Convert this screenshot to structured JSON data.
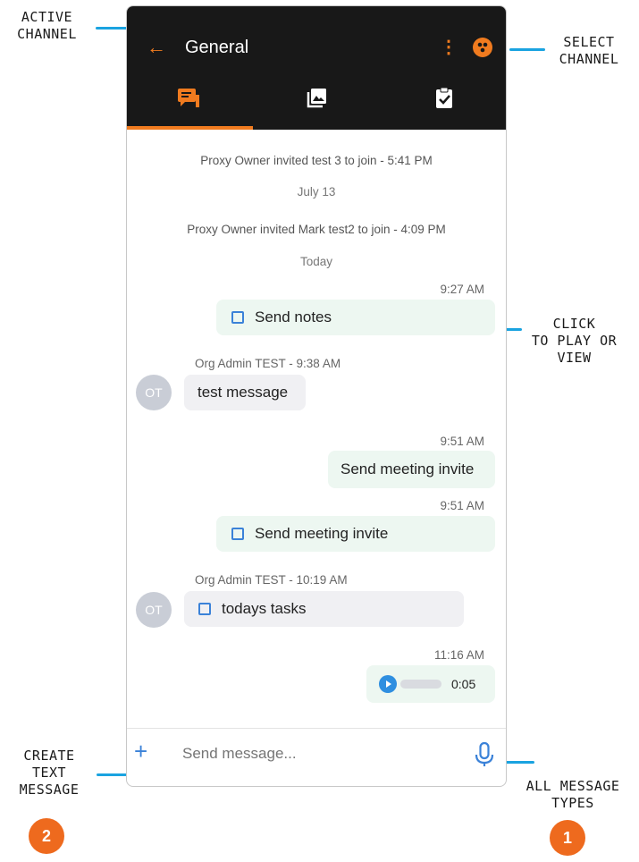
{
  "callouts": {
    "active_channel": [
      "ACTIVE",
      "CHANNEL"
    ],
    "select_channel": [
      "SELECT",
      "CHANNEL"
    ],
    "click_to_play": [
      "CLICK",
      "TO PLAY OR",
      "VIEW"
    ],
    "create_text": [
      "CREATE",
      "TEXT",
      "MESSAGE"
    ],
    "all_types": [
      "ALL MESSAGE",
      "TYPES"
    ],
    "badge_left": "2",
    "badge_right": "1"
  },
  "header": {
    "back_icon": "arrow-left",
    "title": "General",
    "menu_icon": "kebab-vertical",
    "channel_icon": "channel-select"
  },
  "tabs": [
    {
      "icon": "chat-icon",
      "active": true
    },
    {
      "icon": "gallery-icon",
      "active": false
    },
    {
      "icon": "clipboard-check-icon",
      "active": false
    }
  ],
  "messages": {
    "sys1": "Proxy Owner invited test 3 to join - 5:41 PM",
    "date1": "July 13",
    "sys2": "Proxy Owner invited Mark test2 to join - 4:09 PM",
    "date2": "Today",
    "t1": "9:27 AM",
    "m1": "Send notes",
    "s1": "Org Admin TEST - 9:38 AM",
    "av1": "OT",
    "m2": "test message",
    "t2": "9:51 AM",
    "m3": "Send meeting invite",
    "t3": "9:51 AM",
    "m4": "Send meeting invite",
    "s2": "Org Admin TEST - 10:19 AM",
    "av2": "OT",
    "m5": "todays tasks",
    "t4": "11:16 AM",
    "audio_duration": "0:05"
  },
  "composer": {
    "placeholder": "Send message...",
    "add_icon": "plus",
    "mic_icon": "microphone"
  },
  "colors": {
    "accent": "#f07b1f",
    "header_bg": "#181818",
    "link": "#3b82d8",
    "callout_line": "#1aa3e0",
    "badge": "#ee6a1e"
  }
}
